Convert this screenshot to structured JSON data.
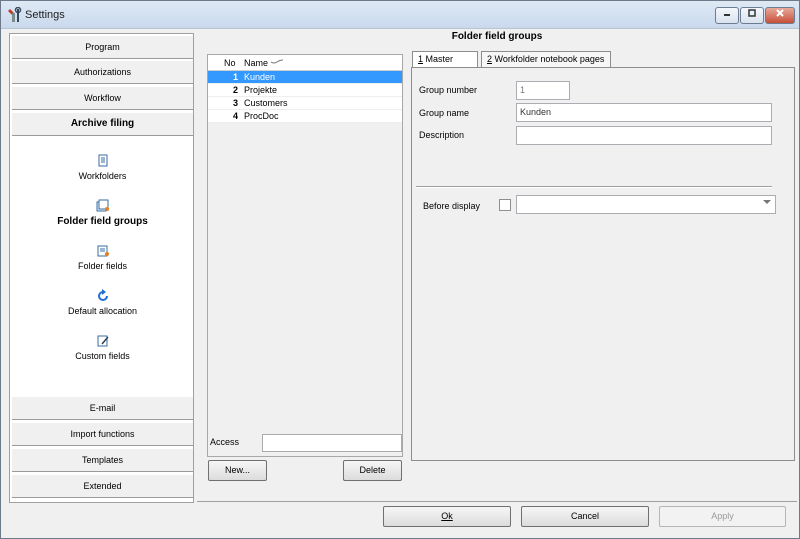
{
  "window": {
    "title": "Settings"
  },
  "nav": {
    "top_items": [
      {
        "label": "Program"
      },
      {
        "label": "Authorizations"
      },
      {
        "label": "Workflow"
      },
      {
        "label": "Archive filing"
      }
    ],
    "sub_items": [
      {
        "label": "Workfolders",
        "icon": "document-icon"
      },
      {
        "label": "Folder field groups",
        "icon": "folder-group-icon"
      },
      {
        "label": "Folder fields",
        "icon": "folder-field-icon"
      },
      {
        "label": "Default allocation",
        "icon": "refresh-icon"
      },
      {
        "label": "Custom fields",
        "icon": "edit-note-icon"
      }
    ],
    "bottom_items": [
      {
        "label": "E-mail"
      },
      {
        "label": "Import functions"
      },
      {
        "label": "Templates"
      },
      {
        "label": "Extended"
      }
    ]
  },
  "panel": {
    "title": "Folder field groups"
  },
  "list": {
    "headers": {
      "no": "No",
      "name": "Name"
    },
    "rows": [
      {
        "no": "1",
        "name": "Kunden"
      },
      {
        "no": "2",
        "name": "Projekte"
      },
      {
        "no": "3",
        "name": "Customers"
      },
      {
        "no": "4",
        "name": "ProcDoc"
      }
    ],
    "selected": 0
  },
  "access": {
    "label": "Access",
    "value": ""
  },
  "buttons": {
    "new": "New...",
    "delete": "Delete",
    "ok": "Ok",
    "cancel": "Cancel",
    "apply": "Apply"
  },
  "tabs": [
    {
      "key": "1",
      "label": " Master Data"
    },
    {
      "key": "2",
      "label": " Workfolder notebook pages"
    }
  ],
  "form": {
    "group_number_label": "Group number",
    "group_number_value": "1",
    "group_name_label": "Group name",
    "group_name_value": "Kunden",
    "description_label": "Description",
    "description_value": "",
    "before_display_label": "Before display",
    "before_display_value": ""
  }
}
